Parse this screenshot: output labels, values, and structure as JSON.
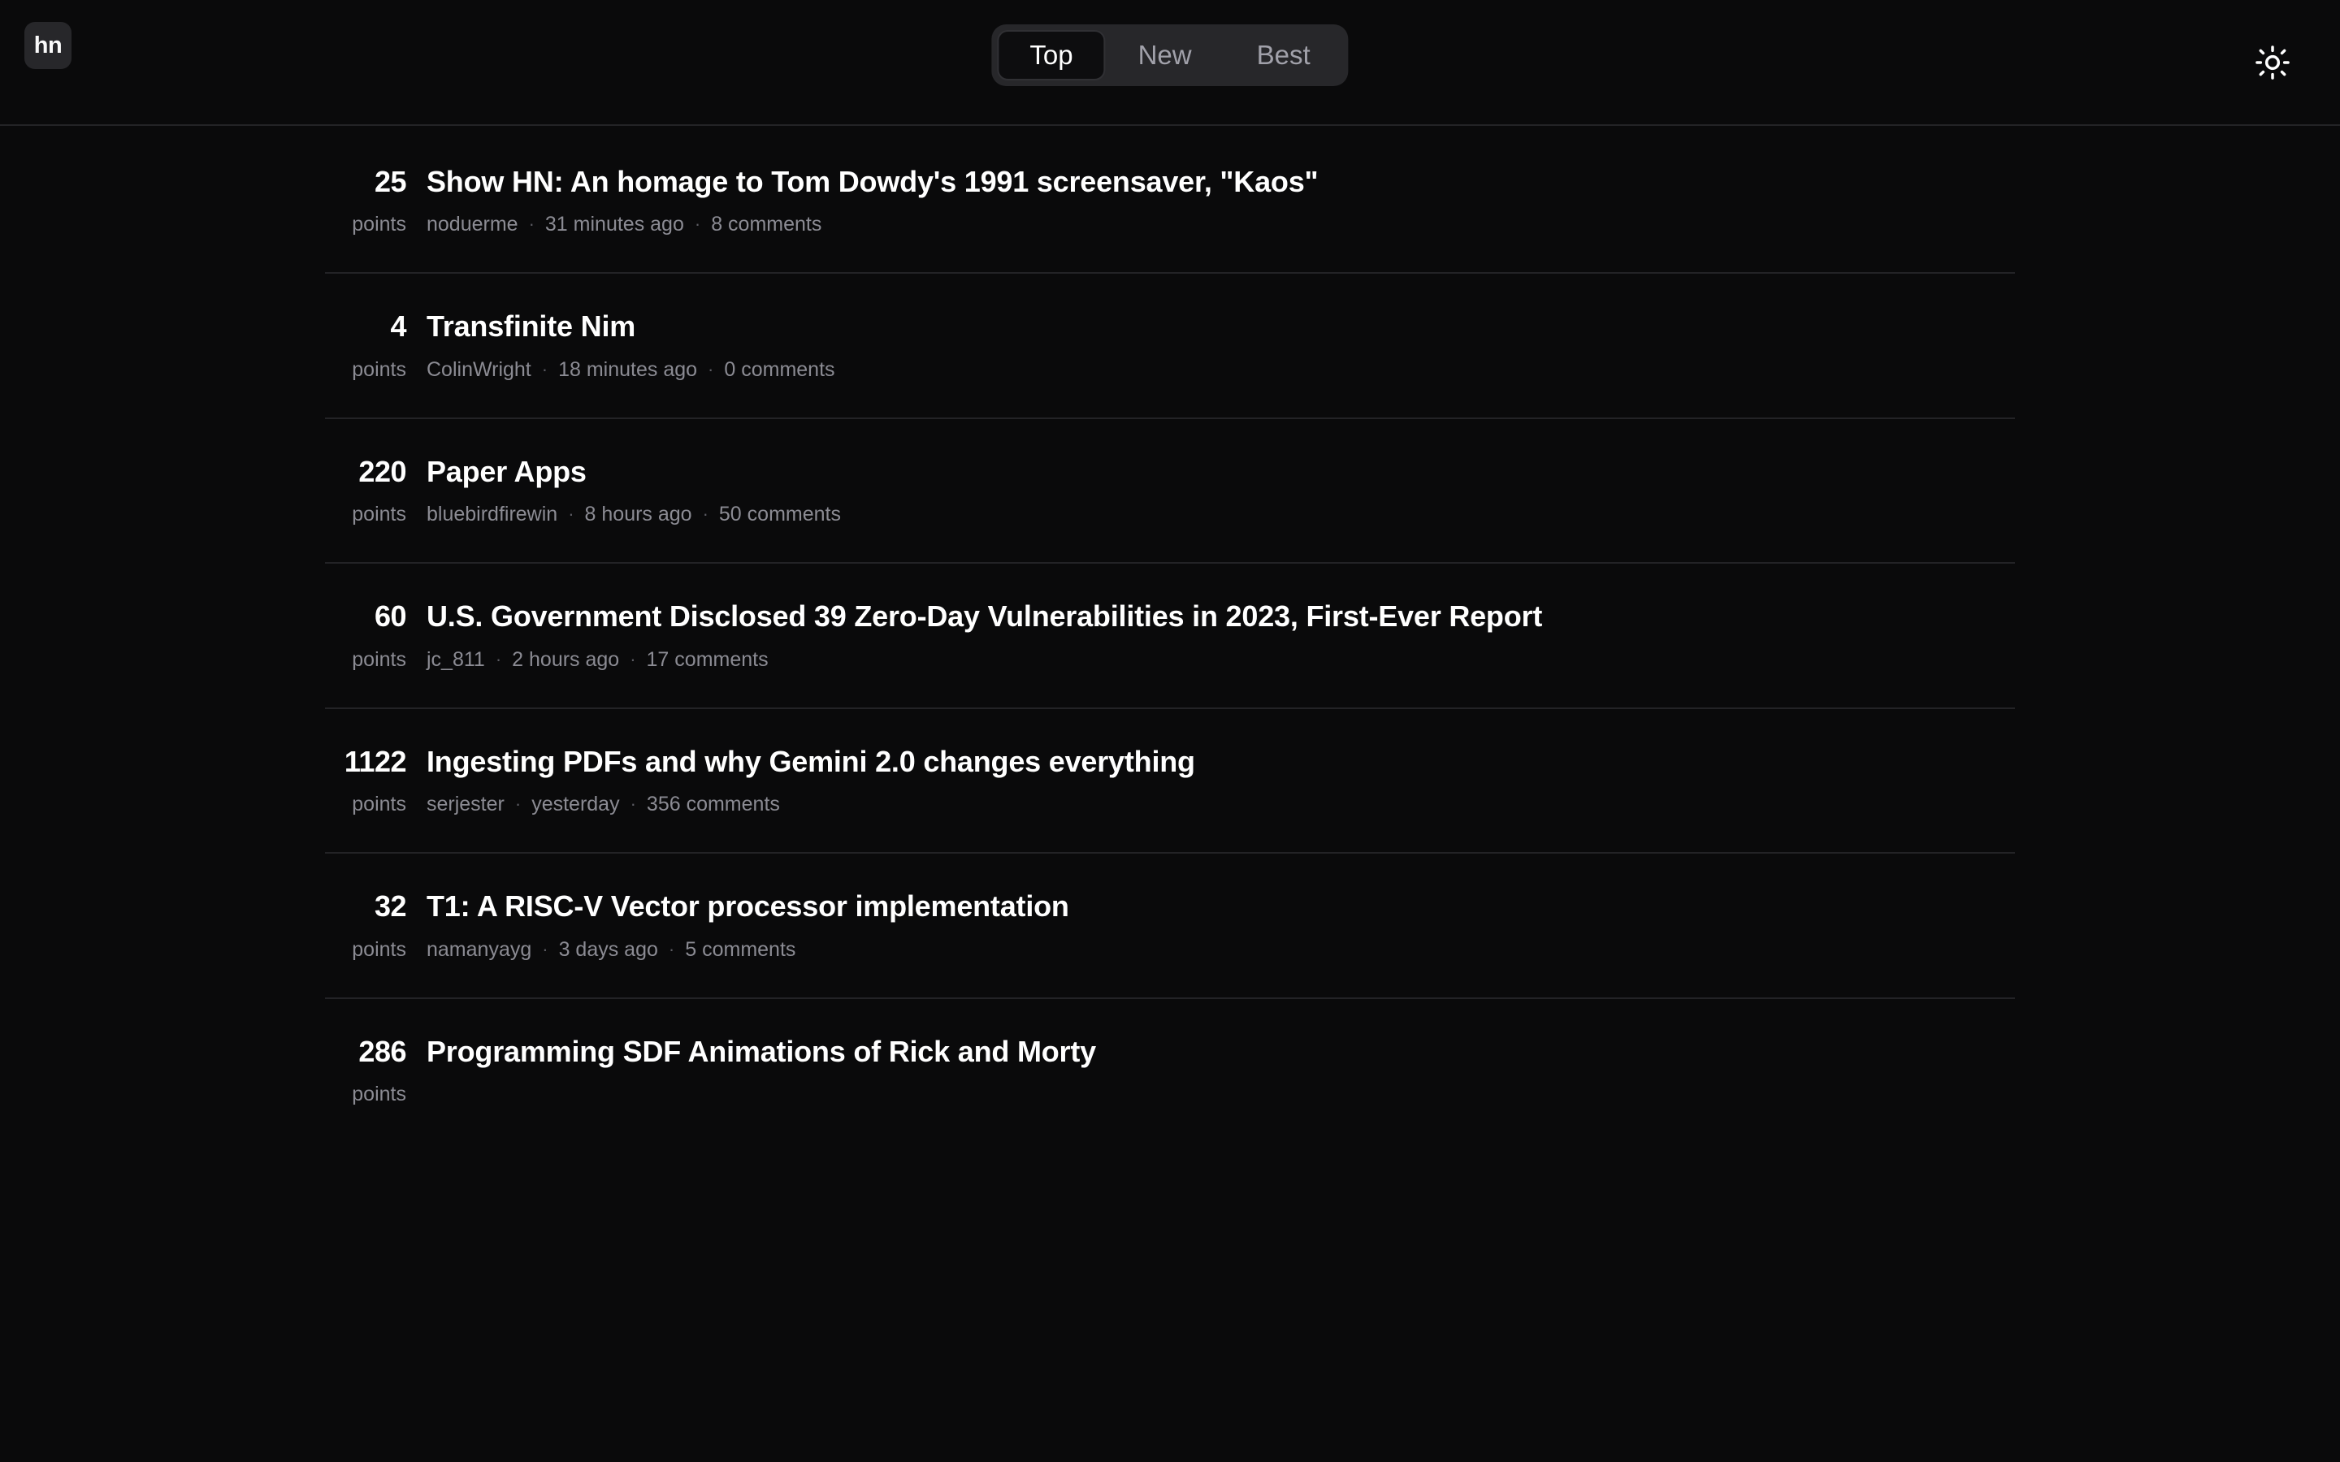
{
  "header": {
    "logo_text": "hn",
    "logo_name": "hn-logo",
    "tabs": [
      {
        "label": "Top",
        "active": true
      },
      {
        "label": "New",
        "active": false
      },
      {
        "label": "Best",
        "active": false
      }
    ],
    "theme_toggle_icon": "sun-icon"
  },
  "colors": {
    "background": "#0a0a0b",
    "surface": "#27272a",
    "active_pill": "#0d0d0f",
    "text_primary": "#ffffff",
    "text_muted": "#8b8b93",
    "divider": "#232326"
  },
  "stories": [
    {
      "score": "25",
      "points_label": "points",
      "title": "Show HN: An homage to Tom Dowdy's 1991 screensaver, \"Kaos\"",
      "author": "noduerme",
      "time": "31 minutes ago",
      "comments": "8 comments"
    },
    {
      "score": "4",
      "points_label": "points",
      "title": "Transfinite Nim",
      "author": "ColinWright",
      "time": "18 minutes ago",
      "comments": "0 comments"
    },
    {
      "score": "220",
      "points_label": "points",
      "title": "Paper Apps",
      "author": "bluebirdfirewin",
      "time": "8 hours ago",
      "comments": "50 comments"
    },
    {
      "score": "60",
      "points_label": "points",
      "title": "U.S. Government Disclosed 39 Zero-Day Vulnerabilities in 2023, First-Ever Report",
      "author": "jc_811",
      "time": "2 hours ago",
      "comments": "17 comments"
    },
    {
      "score": "1122",
      "points_label": "points",
      "title": "Ingesting PDFs and why Gemini 2.0 changes everything",
      "author": "serjester",
      "time": "yesterday",
      "comments": "356 comments"
    },
    {
      "score": "32",
      "points_label": "points",
      "title": "T1: A RISC-V Vector processor implementation",
      "author": "namanyayg",
      "time": "3 days ago",
      "comments": "5 comments"
    },
    {
      "score": "286",
      "points_label": "points",
      "title": "Programming SDF Animations of Rick and Morty",
      "author": "",
      "time": "",
      "comments": ""
    }
  ],
  "separator": "·"
}
